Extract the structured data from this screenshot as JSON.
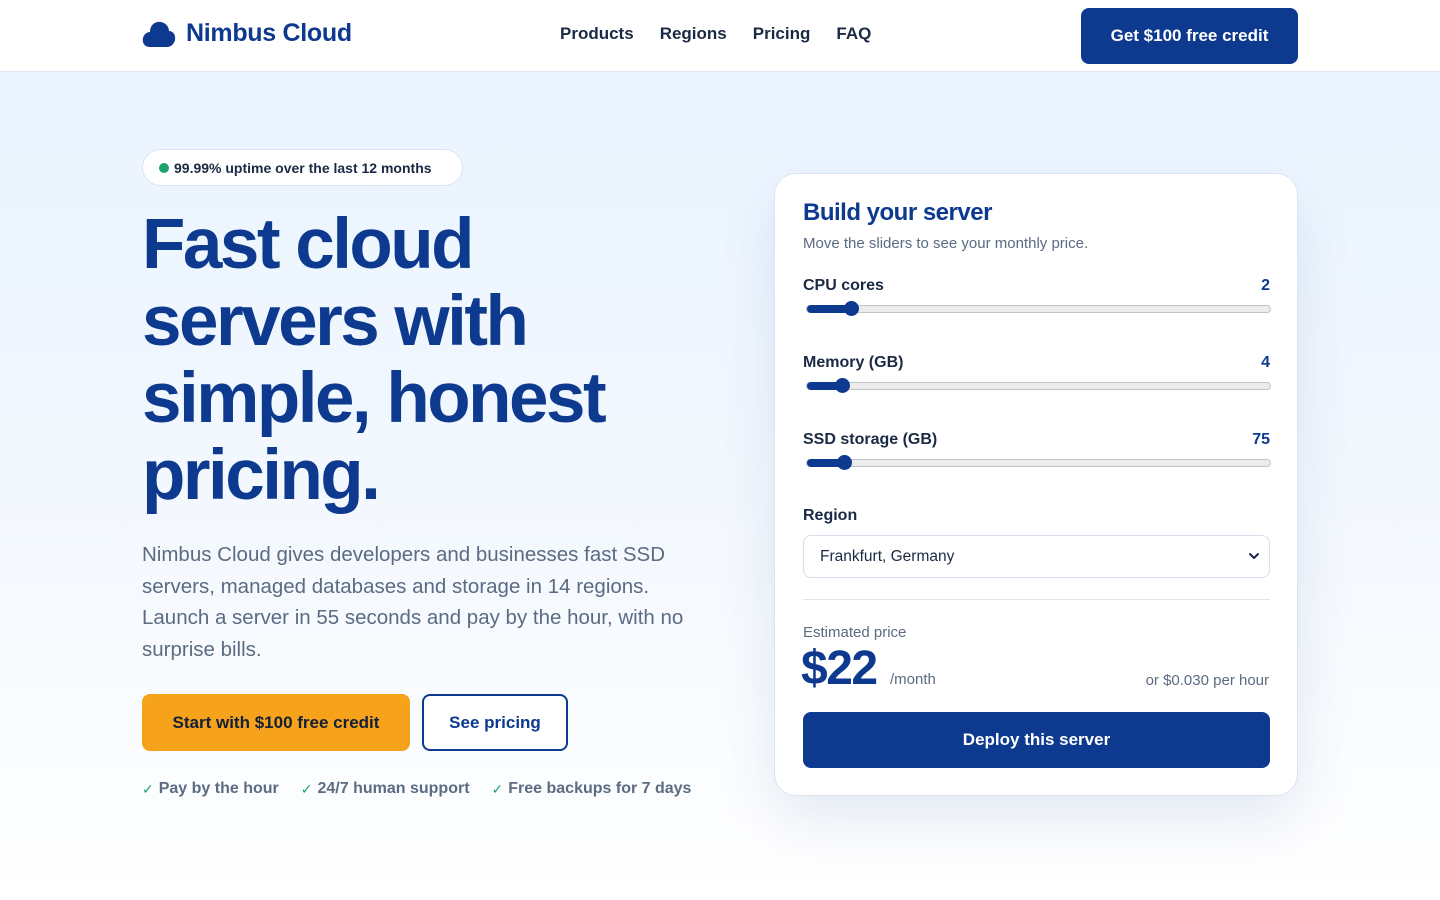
{
  "header": {
    "brand": "Nimbus Cloud",
    "nav": [
      "Products",
      "Regions",
      "Pricing",
      "FAQ"
    ],
    "cta": "Get $100 free credit"
  },
  "hero": {
    "badge": "99.99% uptime over the last 12 months",
    "title_lines": [
      "Fast cloud",
      "servers with",
      "simple, honest",
      "pricing."
    ],
    "subtitle": "Nimbus Cloud gives developers and businesses fast SSD servers, managed databases and storage in 14 regions. Launch a server in 55 seconds and pay by the hour, with no surprise bills.",
    "primary_cta": "Start with $100 free credit",
    "secondary_cta": "See pricing",
    "perks": [
      "Pay by the hour",
      "24/7 human support",
      "Free backups for 7 days"
    ]
  },
  "builder": {
    "title": "Build your server",
    "subtitle": "Move the sliders to see your monthly price.",
    "sliders": [
      {
        "label": "CPU cores",
        "value": "2",
        "level": 0.08
      },
      {
        "label": "Memory (GB)",
        "value": "4",
        "level": 0.06
      },
      {
        "label": "SSD storage (GB)",
        "value": "75",
        "level": 0.065
      }
    ],
    "region_label": "Region",
    "region_value": "Frankfurt, Germany",
    "estimate_label": "Estimated price",
    "price": "$22",
    "period": "/month",
    "hourly": "or $0.030 per hour",
    "deploy": "Deploy this server"
  },
  "colors": {
    "brand": "#0d3a8e",
    "accent": "#f7a21b",
    "success": "#1aa36c"
  }
}
